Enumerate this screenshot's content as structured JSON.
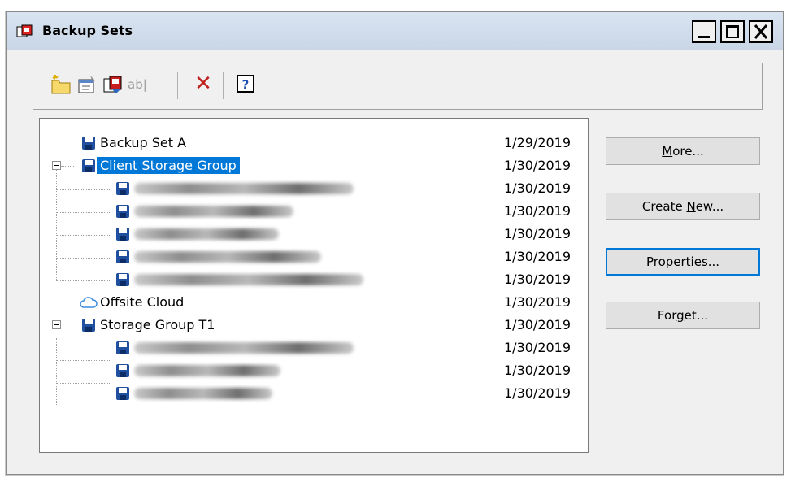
{
  "window": {
    "title": "Backup Sets",
    "controls": {
      "minimize": "_",
      "maximize": "□",
      "close": "X"
    }
  },
  "toolbar": {
    "buttons": [
      {
        "name": "new-folder-icon"
      },
      {
        "name": "properties-icon"
      },
      {
        "name": "backup-icon"
      },
      {
        "name": "rename-icon",
        "label": "ab|"
      },
      {
        "name": "delete-icon",
        "label": "✕"
      },
      {
        "name": "help-icon",
        "label": "?"
      }
    ]
  },
  "tree": {
    "rows": [
      {
        "label": "Backup Set A",
        "date": "1/29/2019",
        "level": 0,
        "icon": "floppy-icon"
      },
      {
        "label": "Client Storage Group",
        "date": "1/30/2019",
        "level": 0,
        "icon": "floppy-icon",
        "selected": true,
        "expanded": true
      },
      {
        "label": "",
        "date": "1/30/2019",
        "level": 1,
        "icon": "floppy-icon",
        "redacted": true
      },
      {
        "label": "",
        "date": "1/30/2019",
        "level": 1,
        "icon": "floppy-icon",
        "redacted": true
      },
      {
        "label": "",
        "date": "1/30/2019",
        "level": 1,
        "icon": "floppy-icon",
        "redacted": true
      },
      {
        "label": "",
        "date": "1/30/2019",
        "level": 1,
        "icon": "floppy-icon",
        "redacted": true
      },
      {
        "label": "",
        "date": "1/30/2019",
        "level": 1,
        "icon": "floppy-icon",
        "redacted": true
      },
      {
        "label": "Offsite Cloud",
        "date": "1/30/2019",
        "level": 0,
        "icon": "cloud-icon"
      },
      {
        "label": "Storage Group T1",
        "date": "1/30/2019",
        "level": 0,
        "icon": "floppy-icon",
        "expanded": true
      },
      {
        "label": "",
        "date": "1/30/2019",
        "level": 1,
        "icon": "floppy-icon",
        "redacted": true
      },
      {
        "label": "",
        "date": "1/30/2019",
        "level": 1,
        "icon": "floppy-icon",
        "redacted": true
      },
      {
        "label": "",
        "date": "1/30/2019",
        "level": 1,
        "icon": "floppy-icon",
        "redacted": true
      }
    ]
  },
  "buttons": {
    "more": {
      "pre": "",
      "key": "M",
      "post": "ore..."
    },
    "create_new": {
      "pre": "Create ",
      "key": "N",
      "post": "ew..."
    },
    "properties": {
      "pre": "",
      "key": "P",
      "post": "roperties..."
    },
    "forget": {
      "pre": "For",
      "key": "g",
      "post": "et..."
    }
  }
}
